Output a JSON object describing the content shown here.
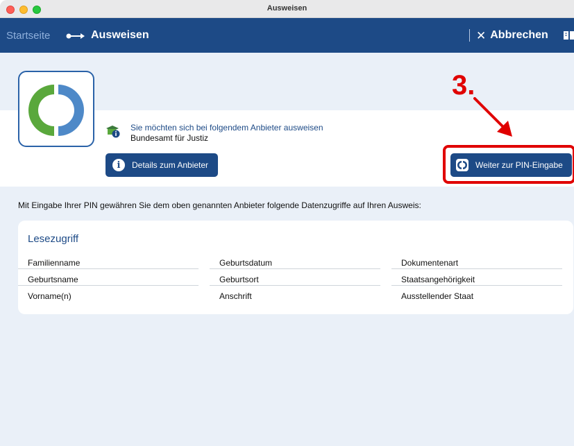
{
  "window": {
    "title": "Ausweisen"
  },
  "navbar": {
    "home_label": "Startseite",
    "current_label": "Ausweisen",
    "cancel_label": "Abbrechen",
    "cancel_icon": "close-icon",
    "book_icon": "book-icon"
  },
  "provider": {
    "question": "Sie möchten sich bei folgendem Anbieter ausweisen",
    "name": "Bundesamt für Justiz",
    "details_button": "Details zum Anbieter"
  },
  "annotation": {
    "step": "3."
  },
  "continue_button": {
    "label": "Weiter zur PIN-Eingabe"
  },
  "consent_text": "Mit Eingabe Ihrer PIN gewähren Sie dem oben genannten Anbieter folgende Datenzugriffe auf Ihren Ausweis:",
  "read_access": {
    "title": "Lesezugriff",
    "columns": [
      [
        "Familienname",
        "Geburtsname",
        "Vorname(n)"
      ],
      [
        "Geburtsdatum",
        "Geburtsort",
        "Anschrift"
      ],
      [
        "Dokumentenart",
        "Staatsangehörigkeit",
        "Ausstellender Staat"
      ]
    ]
  },
  "colors": {
    "brand_blue": "#1d4a86",
    "highlight_red": "#e00000",
    "logo_green": "#5aa83c",
    "logo_blue": "#4e89c8"
  }
}
